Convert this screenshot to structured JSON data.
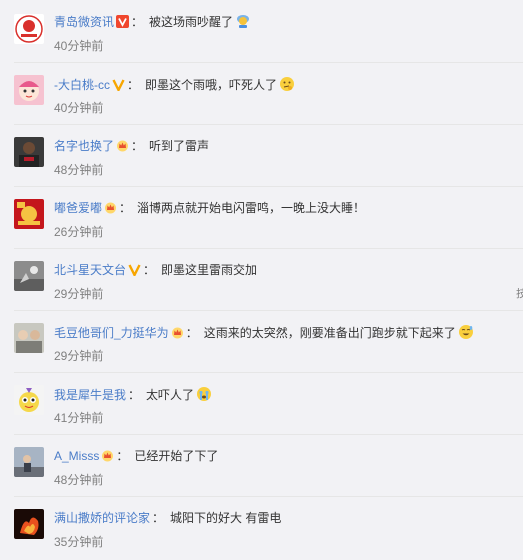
{
  "comments": [
    {
      "username": "青岛微资讯",
      "badge": "verified-v-red",
      "text": "被这场雨吵醒了",
      "emoji": "rain-cloud-emoji",
      "time": "40分钟前"
    },
    {
      "username": "-大白桃-cc",
      "badge": "verified-v-yellow",
      "text": "即墨这个雨哦，吓死人了",
      "emoji": "thinking-face-emoji",
      "time": "40分钟前"
    },
    {
      "username": "名字也换了",
      "badge": "vip-crown",
      "text": "听到了雷声",
      "emoji": "",
      "time": "48分钟前"
    },
    {
      "username": "嘟爸爱嘟",
      "badge": "vip-crown",
      "text": "淄博两点就开始电闪雷鸣，一晚上没大睡！",
      "emoji": "",
      "time": "26分钟前"
    },
    {
      "username": "北斗星天文台",
      "badge": "verified-v-yellow",
      "text": "即墨这里雷雨交加",
      "emoji": "",
      "time": "29分钟前"
    },
    {
      "username": "毛豆他哥们_力挺华为",
      "badge": "vip-crown",
      "text": "这雨来的太突然，刚要准备出门跑步就下起来了",
      "emoji": "sweat-smile-emoji",
      "time": "29分钟前"
    },
    {
      "username": "我是犀牛是我",
      "badge": "",
      "text": "太吓人了",
      "emoji": "crying-face-emoji",
      "time": "41分钟前"
    },
    {
      "username": "A_Misss",
      "badge": "vip-crown",
      "text": "已经开始了下了",
      "emoji": "",
      "time": "48分钟前"
    },
    {
      "username": "满山撒娇的评论家",
      "badge": "",
      "text": "城阳下的好大 有雷电",
      "emoji": "",
      "time": "35分钟前"
    }
  ],
  "separator": "：",
  "edge_text": "技"
}
